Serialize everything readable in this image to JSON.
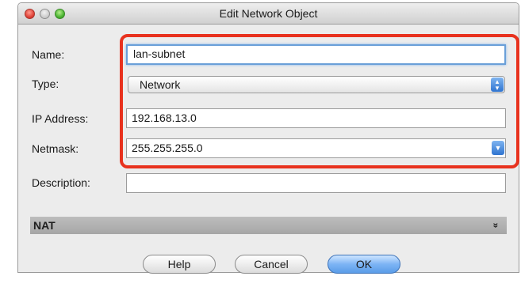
{
  "window": {
    "title": "Edit Network Object"
  },
  "form": {
    "name": {
      "label": "Name:",
      "value": "lan-subnet"
    },
    "type": {
      "label": "Type:",
      "value": "Network"
    },
    "ip_address": {
      "label": "IP Address:",
      "value": "192.168.13.0"
    },
    "netmask": {
      "label": "Netmask:",
      "value": "255.255.255.0"
    },
    "description": {
      "label": "Description:",
      "value": ""
    }
  },
  "nat": {
    "label": "NAT",
    "icon": "double-chevron-down-icon"
  },
  "buttons": {
    "help": "Help",
    "cancel": "Cancel",
    "ok": "OK"
  },
  "colors": {
    "highlight": "#e8321e",
    "focus": "#6a9fd8",
    "ok_button": "#5a9de8"
  }
}
